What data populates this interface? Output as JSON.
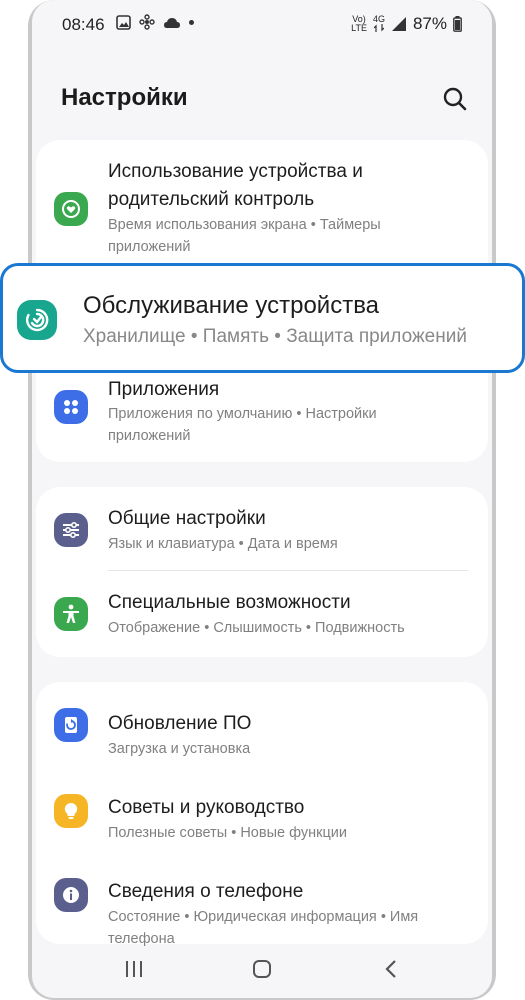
{
  "status": {
    "time": "08:46",
    "battery": "87%",
    "network_top": "Vo)",
    "network_bottom": "LTE",
    "net_gen": "4G"
  },
  "header": {
    "title": "Настройки"
  },
  "items": [
    {
      "name_line1": "Использование устройства и",
      "name_line2": "родительский контроль",
      "sub_line1": "Время использования экрана • Таймеры",
      "sub_line2": "приложений",
      "icon": "heart-clock-icon",
      "color": "#3aa84f"
    },
    {
      "name": "Обслуживание устройства",
      "sub": "Хранилище • Память • Защита приложений",
      "icon": "device-care-icon",
      "color": "#18a68e"
    },
    {
      "name": "Приложения",
      "sub_line1": "Приложения по умолчанию • Настройки",
      "sub_line2": "приложений",
      "icon": "apps-grid-icon",
      "color": "#3d6ee8"
    },
    {
      "name": "Общие настройки",
      "sub": "Язык и клавиатура • Дата и время",
      "icon": "sliders-icon",
      "color": "#5b5f8e"
    },
    {
      "name": "Специальные возможности",
      "sub": "Отображение • Слышимость • Подвижность",
      "icon": "accessibility-icon",
      "color": "#3aa84f"
    },
    {
      "name": "Обновление ПО",
      "sub": "Загрузка и установка",
      "icon": "update-icon",
      "color": "#3d6ee8"
    },
    {
      "name": "Советы и руководство",
      "sub": "Полезные советы • Новые функции",
      "icon": "lightbulb-icon",
      "color": "#f6b525"
    },
    {
      "name": "Сведения о телефоне",
      "sub_line1": "Состояние • Юридическая информация • Имя",
      "sub_line2": "телефона",
      "icon": "info-icon",
      "color": "#5b5f8e"
    }
  ],
  "navbar": {
    "recents": "|||",
    "home": "○",
    "back": "‹"
  }
}
